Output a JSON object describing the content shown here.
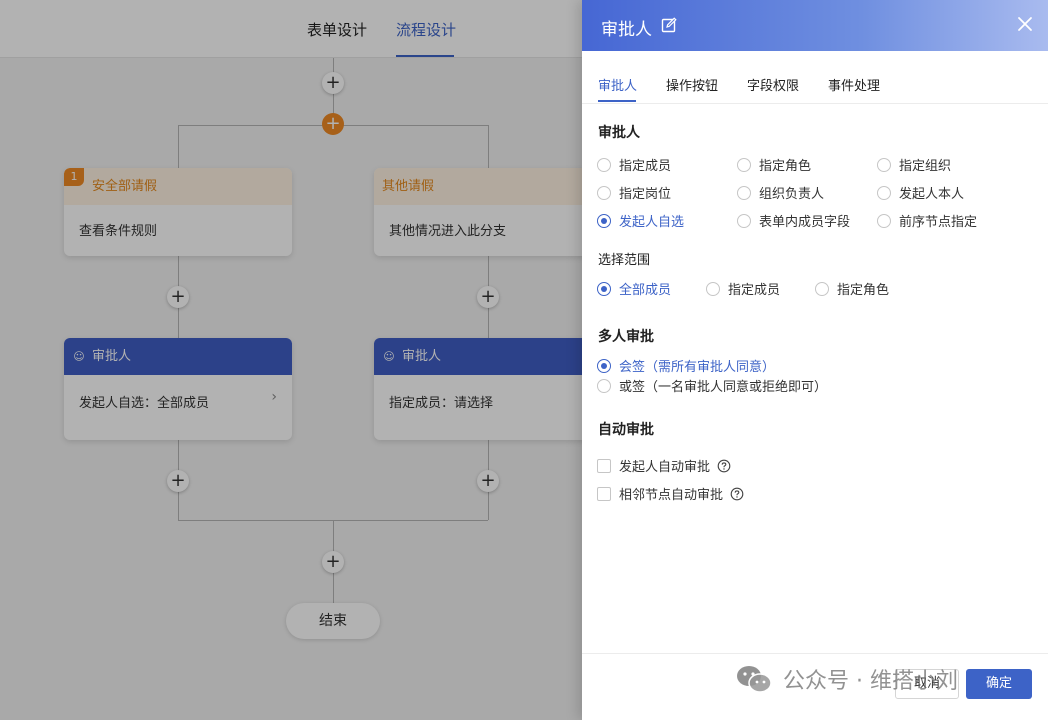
{
  "top_tabs": [
    "表单设计",
    "流程设计"
  ],
  "flow": {
    "branches": [
      {
        "badge": "1",
        "title": "安全部请假",
        "condition": "查看条件规则",
        "approver_title": "审批人",
        "approver_value": "发起人自选：全部成员"
      },
      {
        "badge": "",
        "title": "其他请假",
        "condition": "其他情况进入此分支",
        "approver_title": "审批人",
        "approver_value": "指定成员：请选择"
      }
    ],
    "end_label": "结束",
    "add_symbol": "+"
  },
  "drawer": {
    "title": "审批人",
    "tabs": [
      "审批人",
      "操作按钮",
      "字段权限",
      "事件处理"
    ],
    "approver_section": {
      "title": "审批人",
      "options": [
        "指定成员",
        "指定角色",
        "指定组织",
        "指定岗位",
        "组织负责人",
        "发起人本人",
        "发起人自选",
        "表单内成员字段",
        "前序节点指定"
      ],
      "selected": "发起人自选"
    },
    "scope_section": {
      "title": "选择范围",
      "options": [
        "全部成员",
        "指定成员",
        "指定角色"
      ],
      "selected": "全部成员"
    },
    "multi_section": {
      "title": "多人审批",
      "options": [
        "会签（需所有审批人同意）",
        "或签（一名审批人同意或拒绝即可）"
      ],
      "selected": "会签（需所有审批人同意）"
    },
    "auto_section": {
      "title": "自动审批",
      "options": [
        "发起人自动审批",
        "相邻节点自动审批"
      ]
    },
    "footer": {
      "cancel": "取消",
      "ok": "确定"
    }
  },
  "watermark": {
    "text": "公众号 · 维搭小刘"
  },
  "colors": {
    "primary": "#3d63c7",
    "orange": "#f08a24",
    "header_gradient_start": "#4667d4"
  },
  "icons": [
    "edit-icon",
    "close-icon",
    "user-icon",
    "chevron-right-icon",
    "question-icon",
    "wechat-icon"
  ]
}
